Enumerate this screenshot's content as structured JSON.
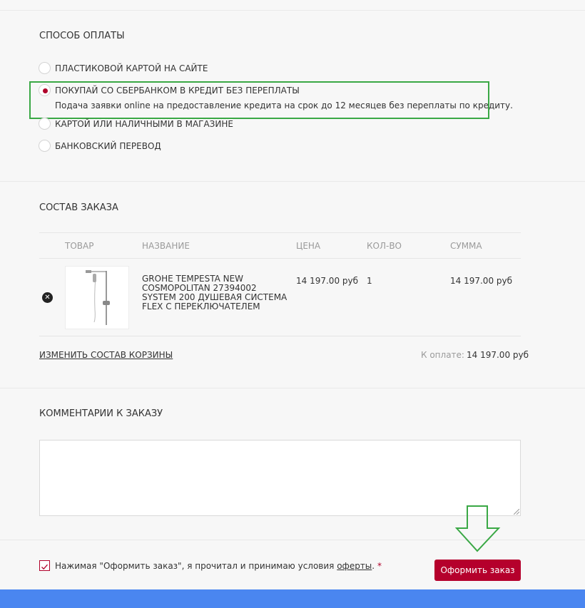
{
  "payment": {
    "title": "СПОСОБ ОПЛАТЫ",
    "options": [
      {
        "label": "ПЛАСТИКОВОЙ КАРТОЙ НА САЙТЕ",
        "checked": false
      },
      {
        "label": "ПОКУПАЙ СО СБЕРБАНКОМ В КРЕДИТ БЕЗ ПЕРЕПЛАТЫ",
        "checked": true,
        "description": "Подача заявки online на предоставление кредита на срок до 12 месяцев без переплаты по кредиту."
      },
      {
        "label": "КАРТОЙ ИЛИ НАЛИЧНЫМИ В МАГАЗИНЕ",
        "checked": false
      },
      {
        "label": "БАНКОВСКИЙ ПЕРЕВОД",
        "checked": false
      }
    ]
  },
  "order": {
    "title": "СОСТАВ ЗАКАЗА",
    "columns": [
      "ТОВАР",
      "НАЗВАНИЕ",
      "ЦЕНА",
      "КОЛ-ВО",
      "СУММА"
    ],
    "items": [
      {
        "name": "GROHE TEMPESTA NEW COSMOPOLITAN 27394002 SYSTEM 200 ДУШЕВАЯ СИСТЕМА FLEX С ПЕРЕКЛЮЧАТЕЛЕМ",
        "price": "14 197.00 руб",
        "qty": "1",
        "sum": "14 197.00 руб"
      }
    ],
    "change_link": "ИЗМЕНИТЬ СОСТАВ КОРЗИНЫ",
    "total_label": "К оплате:",
    "total_value": "14 197.00 руб"
  },
  "comments": {
    "title": "КОММЕНТАРИИ К ЗАКАЗУ",
    "value": ""
  },
  "agreement": {
    "text_before": "Нажимая \"Оформить заказ\", я прочитал и принимаю условия ",
    "link": "оферты",
    "text_after": ".",
    "required_mark": "*",
    "checked": true
  },
  "submit_label": "Оформить заказ",
  "colors": {
    "accent": "#b5002c",
    "highlight": "#3aa845",
    "bottom_bar": "#4a86f0"
  }
}
